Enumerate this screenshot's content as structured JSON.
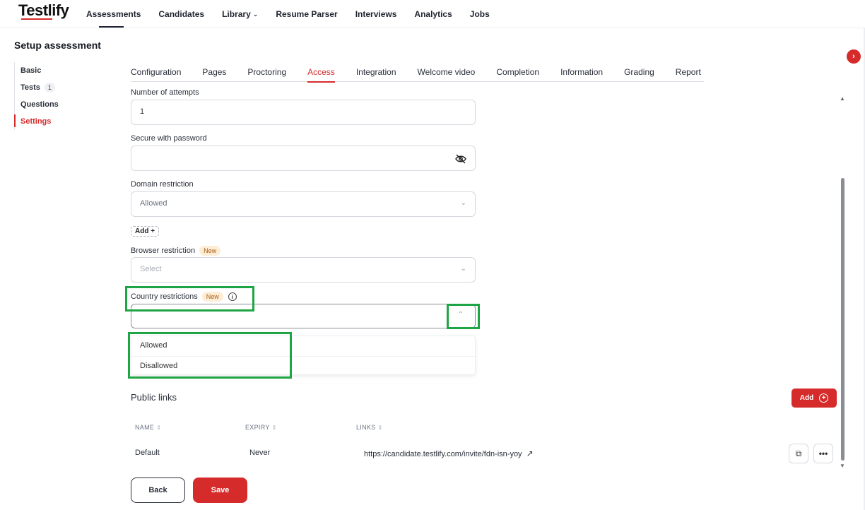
{
  "brand": {
    "logo": "Testlify",
    "accent": "#d62b2b",
    "highlight": "#1ea545"
  },
  "nav": {
    "items": [
      "Assessments",
      "Candidates",
      "Library",
      "Resume Parser",
      "Interviews",
      "Analytics",
      "Jobs"
    ],
    "library_chevron": "chevron-down-icon"
  },
  "page": {
    "title": "Setup assessment"
  },
  "steps": {
    "basic": "Basic",
    "tests": "Tests",
    "tests_count": "1",
    "questions": "Questions",
    "settings": "Settings"
  },
  "tabs": [
    "Configuration",
    "Pages",
    "Proctoring",
    "Access",
    "Integration",
    "Welcome video",
    "Completion",
    "Information",
    "Grading",
    "Report"
  ],
  "form": {
    "attempts_label": "Number of attempts",
    "attempts_value": "1",
    "password_label": "Secure with password",
    "password_value": "",
    "domain_label": "Domain restriction",
    "domain_value": "Allowed",
    "add_chip": "Add +",
    "browser_label": "Browser restriction",
    "browser_badge": "New",
    "browser_placeholder": "Select",
    "country_label": "Country restrictions",
    "country_badge": "New",
    "country_value": "",
    "country_options": [
      "Allowed",
      "Disallowed"
    ]
  },
  "public_links": {
    "title": "Public links",
    "add_label": "Add",
    "columns": [
      "NAME",
      "EXPIRY",
      "LINKS"
    ],
    "rows": [
      {
        "name": "Default",
        "expiry": "Never",
        "link": "https://candidate.testlify.com/invite/fdn-isn-yoy"
      }
    ]
  },
  "footer": {
    "back": "Back",
    "save": "Save"
  }
}
